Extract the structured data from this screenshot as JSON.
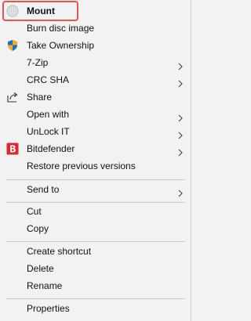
{
  "context_menu": {
    "items": [
      {
        "label": "Mount",
        "icon": "disc-icon"
      },
      {
        "label": "Burn disc image"
      },
      {
        "label": "Take Ownership",
        "icon": "shield-icon"
      },
      {
        "label": "7-Zip",
        "submenu": true
      },
      {
        "label": "CRC SHA",
        "submenu": true
      },
      {
        "label": "Share",
        "icon": "share-icon"
      },
      {
        "label": "Open with",
        "submenu": true
      },
      {
        "label": "UnLock IT",
        "submenu": true
      },
      {
        "label": "Bitdefender",
        "icon": "bitdefender-icon",
        "submenu": true
      },
      {
        "label": "Restore previous versions"
      },
      {
        "label": "Send to",
        "submenu": true
      },
      {
        "label": "Cut"
      },
      {
        "label": "Copy"
      },
      {
        "label": "Create shortcut"
      },
      {
        "label": "Delete"
      },
      {
        "label": "Rename"
      },
      {
        "label": "Properties"
      }
    ]
  },
  "colors": {
    "highlight_border": "#e8544e",
    "menu_background": "#f2f2f2",
    "bitdefender_red": "#e2232a",
    "separator": "#cccccc"
  }
}
